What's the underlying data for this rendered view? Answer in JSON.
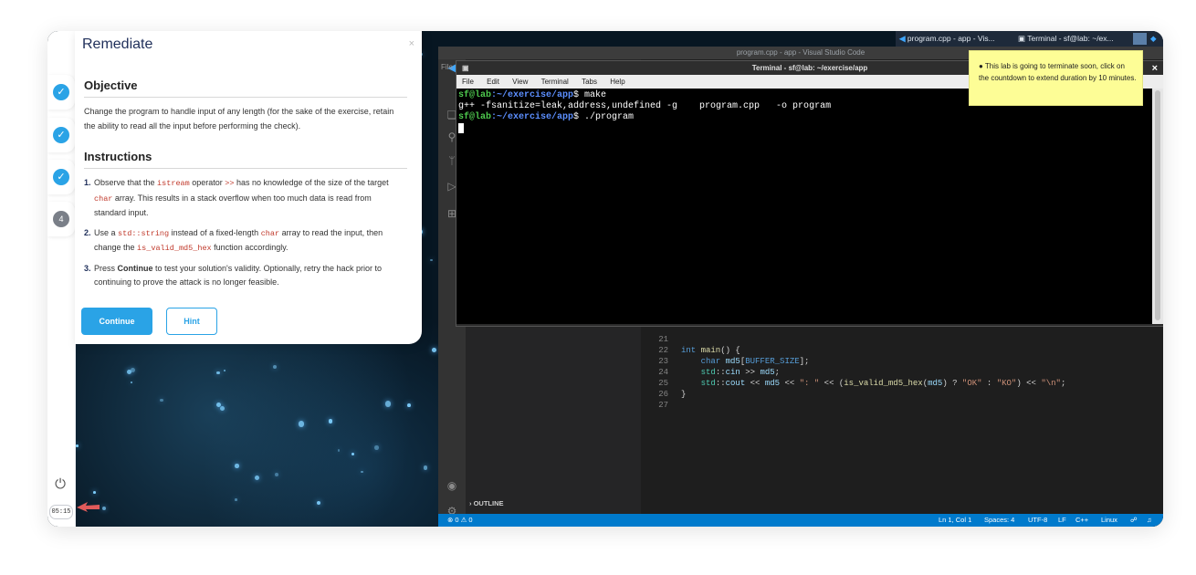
{
  "remediate": {
    "title": "Remediate",
    "close": "×",
    "objective_title": "Objective",
    "objective_text": "Change the program to handle input of any length (for the sake of the exercise, retain the ability to read all the input before performing the check).",
    "instructions_title": "Instructions",
    "steps": [
      {
        "n": "1.",
        "parts": [
          "Observe that the ",
          "istream",
          " operator ",
          ">>",
          " has no knowledge of the size of the target ",
          "char",
          " array. This results in a stack overflow when too much data is read from standard input."
        ]
      },
      {
        "n": "2.",
        "parts": [
          "Use a ",
          "std::string",
          " instead of a fixed-length ",
          "char",
          " array to read the input, then change the ",
          "is_valid_md5_hex",
          " function accordingly."
        ]
      },
      {
        "n": "3.",
        "parts": [
          "Press ",
          "Continue",
          " to test your solution's validity. Optionally, retry the hack prior to continuing to prove the attack is no longer feasible."
        ]
      }
    ],
    "continue_label": "Continue",
    "hint_label": "Hint"
  },
  "rail": {
    "steps": [
      {
        "label": "✓",
        "state": "done"
      },
      {
        "label": "✓",
        "state": "done"
      },
      {
        "label": "✓",
        "state": "done"
      },
      {
        "label": "4",
        "state": "current"
      }
    ],
    "timer": "05:15"
  },
  "taskbar": {
    "vscode_task": "program.cpp - app - Vis...",
    "terminal_task": "Terminal - sf@lab: ~/ex..."
  },
  "vscode": {
    "window_title": "program.cpp - app - Visual Studio Code",
    "file_menu_stub": "File",
    "outline_label": "OUTLINE",
    "line_numbers": [
      "21",
      "22",
      "23",
      "24",
      "25",
      "26",
      "27"
    ],
    "statusbar": {
      "problems": "⊗ 0 ⚠ 0",
      "position": "Ln 1, Col 1",
      "spaces": "Spaces: 4",
      "encoding": "UTF-8",
      "eol": "LF",
      "language": "C++",
      "os": "Linux"
    }
  },
  "terminal": {
    "title": "Terminal - sf@lab: ~/exercise/app",
    "menu": [
      "File",
      "Edit",
      "View",
      "Terminal",
      "Tabs",
      "Help"
    ],
    "prompt_user": "sf@lab",
    "prompt_path": ":~/exercise/app",
    "prompt_symbol": "$",
    "cmd1": " make",
    "output1": "g++ -fsanitize=leak,address,undefined -g    program.cpp   -o program",
    "cmd2": " ./program"
  },
  "notice": {
    "text": "This lab is going to terminate soon, click on the countdown to extend duration by 10 minutes.",
    "close": "×"
  }
}
